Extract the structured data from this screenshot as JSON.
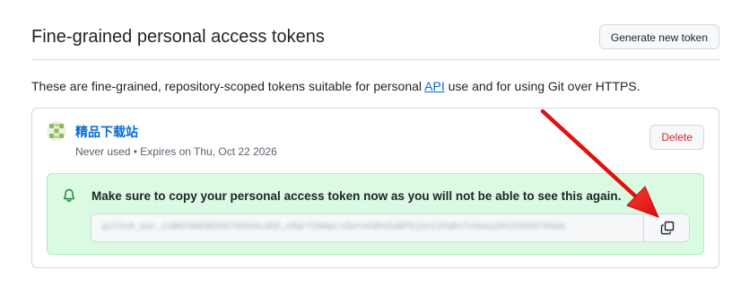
{
  "header": {
    "title": "Fine-grained personal access tokens",
    "generate_button_label": "Generate new token"
  },
  "description": {
    "before_link": "These are fine-grained, repository-scoped tokens suitable for personal ",
    "link_text": "API",
    "after_link": " use and for using Git over HTTPS."
  },
  "token": {
    "name": "精品下载站",
    "meta": "Never used • Expires on Thu, Oct 22 2026",
    "delete_label": "Delete",
    "flash_message": "Make sure to copy your personal access token now as you will not be able to see this again.",
    "value": "github_pat_11BKFAKEREDACTEDVALUE0_x8QrT2mNpLvZwYsKdHcEaBfGjUoIiPqRsTuVwXyZ0123456789ab"
  },
  "icons": {
    "avatar": "identicon",
    "flash": "bell-icon",
    "copy": "copy-icon"
  },
  "colors": {
    "link": "#0969da",
    "danger": "#d1242f",
    "flash_bg": "#dafbe1",
    "flash_border": "#aceebb",
    "annotation": "#e01010"
  }
}
